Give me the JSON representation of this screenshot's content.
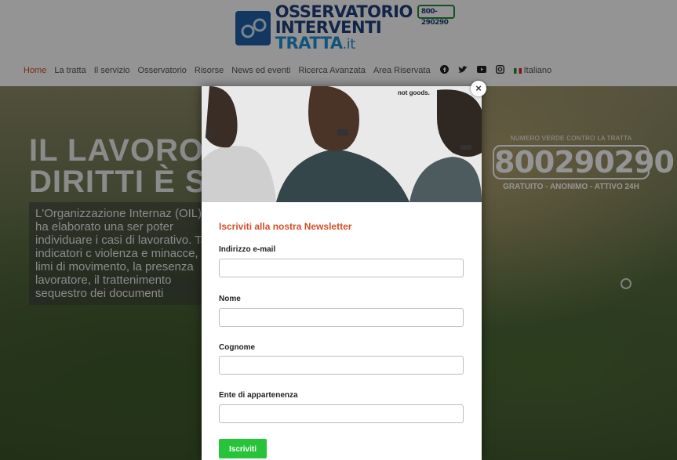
{
  "header": {
    "logo_line1": "OSSERVATORIO",
    "logo_line2_main": "INTERVENTI ",
    "logo_line2_accent": "TRATTA",
    "logo_line2_domain": ".it",
    "logo_phone": "800-290290"
  },
  "nav": {
    "items": [
      "Home",
      "La tratta",
      "Il servizio",
      "Osservatorio",
      "Risorse",
      "News ed eventi",
      "Ricerca Avanzata",
      "Area Riservata"
    ],
    "language": "Italiano"
  },
  "hero": {
    "title_line1": "IL LAVORO",
    "title_line2": "DIRITTI È S",
    "body": "L'Organizzazione Internaz (OIL) ha elaborato una ser poter individuare i casi di lavorativo. Tali indicatori c violenza e minacce, la limi di movimento, la presenza lavoratore, il trattenimento sequestro dei documenti",
    "hotline_caption": "NUMERO VERDE CONTRO LA TRATTA",
    "hotline_number": "800290290",
    "hotline_sub": "GRATUITO - ANONIMO - ATTIVO 24H"
  },
  "modal": {
    "image_caption": "not goods.",
    "title": "Iscriviti alla nostra Newsletter",
    "fields": [
      {
        "label": "Indirizzo e-mail",
        "value": ""
      },
      {
        "label": "Nome",
        "value": ""
      },
      {
        "label": "Cognome",
        "value": ""
      },
      {
        "label": "Ente di appartenenza",
        "value": ""
      }
    ],
    "submit_label": "Iscriviti",
    "close_symbol": "×"
  },
  "icons": [
    "facebook-icon",
    "twitter-icon",
    "youtube-icon",
    "instagram-icon",
    "italy-flag-icon",
    "close-icon"
  ],
  "colors": {
    "accent": "#d2502a",
    "submit": "#27c43b",
    "brand_blue": "#1f3f7a"
  }
}
